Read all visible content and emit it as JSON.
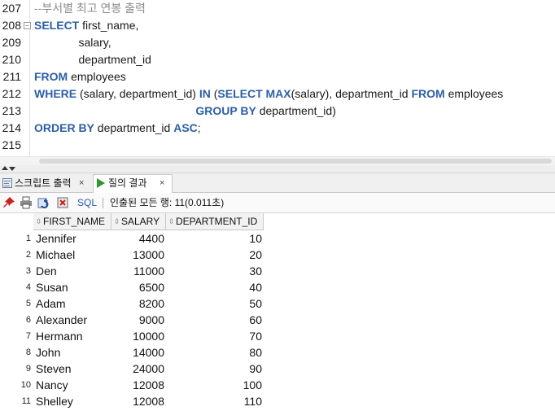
{
  "editor": {
    "line_numbers": [
      "207",
      "208",
      "209",
      "210",
      "211",
      "212",
      "213",
      "214",
      "215"
    ],
    "lines": [
      [
        {
          "t": "--부서별 최고 연봉 출력",
          "c": "cm"
        }
      ],
      [
        {
          "t": "SELECT",
          "c": "kw"
        },
        {
          "t": " first_name,",
          "c": ""
        }
      ],
      [
        {
          "t": "              salary,",
          "c": ""
        }
      ],
      [
        {
          "t": "              department_id",
          "c": ""
        }
      ],
      [
        {
          "t": "FROM",
          "c": "kw"
        },
        {
          "t": " employees",
          "c": ""
        }
      ],
      [
        {
          "t": "WHERE",
          "c": "kw"
        },
        {
          "t": " (salary, department_id) ",
          "c": ""
        },
        {
          "t": "IN",
          "c": "kw"
        },
        {
          "t": " (",
          "c": ""
        },
        {
          "t": "SELECT",
          "c": "kw"
        },
        {
          "t": " ",
          "c": ""
        },
        {
          "t": "MAX",
          "c": "kw"
        },
        {
          "t": "(salary), department_id ",
          "c": ""
        },
        {
          "t": "FROM",
          "c": "kw"
        },
        {
          "t": " employees",
          "c": ""
        }
      ],
      [
        {
          "t": "                                                   ",
          "c": ""
        },
        {
          "t": "GROUP BY",
          "c": "kw"
        },
        {
          "t": " department_id)",
          "c": ""
        }
      ],
      [
        {
          "t": "ORDER BY",
          "c": "kw"
        },
        {
          "t": " department_id ",
          "c": ""
        },
        {
          "t": "ASC",
          "c": "kw"
        },
        {
          "t": ";",
          "c": ""
        }
      ],
      [
        {
          "t": "",
          "c": ""
        }
      ]
    ]
  },
  "tabs": {
    "script_output": "스크립트 출력",
    "query_result": "질의 결과",
    "close_glyph": "×"
  },
  "toolbar": {
    "sql_label": "SQL",
    "fetch_status": "인출된 모든 행: 11(0.011초)"
  },
  "grid": {
    "sort_glyph": "⇳",
    "columns": [
      "FIRST_NAME",
      "SALARY",
      "DEPARTMENT_ID"
    ],
    "rows": [
      [
        "1",
        "Jennifer",
        "4400",
        "10"
      ],
      [
        "2",
        "Michael",
        "13000",
        "20"
      ],
      [
        "3",
        "Den",
        "11000",
        "30"
      ],
      [
        "4",
        "Susan",
        "6500",
        "40"
      ],
      [
        "5",
        "Adam",
        "8200",
        "50"
      ],
      [
        "6",
        "Alexander",
        "9000",
        "60"
      ],
      [
        "7",
        "Hermann",
        "10000",
        "70"
      ],
      [
        "8",
        "John",
        "14000",
        "80"
      ],
      [
        "9",
        "Steven",
        "24000",
        "90"
      ],
      [
        "10",
        "Nancy",
        "12008",
        "100"
      ],
      [
        "11",
        "Shelley",
        "12008",
        "110"
      ]
    ]
  },
  "colors": {
    "keyword": "#2d5fa6",
    "comment": "#8c8c8c",
    "sql_link": "#2b5aa8",
    "run_icon": "#2e9a2e",
    "pin_icon": "#c8221e"
  }
}
